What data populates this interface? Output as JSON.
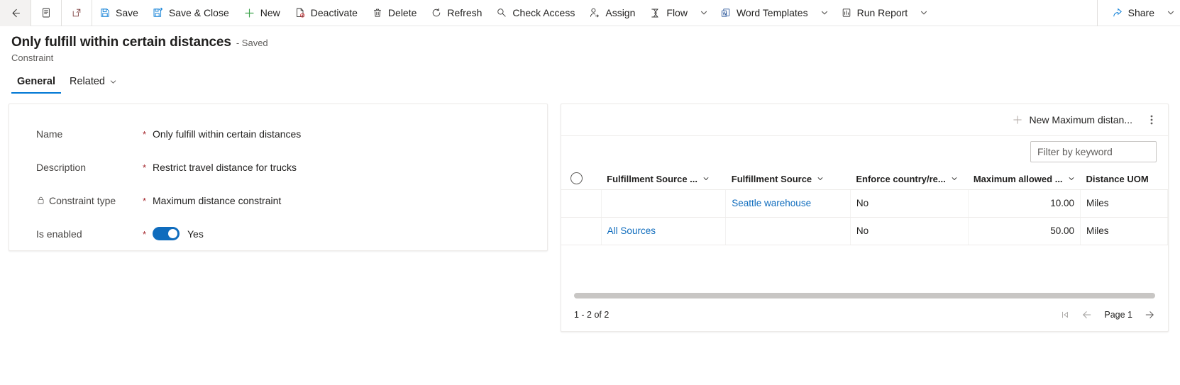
{
  "commandbar": {
    "back": {
      "label": "",
      "icon": "back-arrow-icon"
    },
    "form_selector": {
      "label": "",
      "icon": "form-icon"
    },
    "popout": {
      "label": "",
      "icon": "popout-icon"
    },
    "items": [
      {
        "label": "Save",
        "icon": "save-icon"
      },
      {
        "label": "Save & Close",
        "icon": "save-and-close-icon"
      },
      {
        "label": "New",
        "icon": "plus-icon"
      },
      {
        "label": "Deactivate",
        "icon": "deactivate-icon"
      },
      {
        "label": "Delete",
        "icon": "trash-icon"
      },
      {
        "label": "Refresh",
        "icon": "refresh-icon"
      },
      {
        "label": "Check Access",
        "icon": "key-icon"
      },
      {
        "label": "Assign",
        "icon": "person-assign-icon"
      },
      {
        "label": "Flow",
        "icon": "flow-icon",
        "caret": true
      },
      {
        "label": "Word Templates",
        "icon": "word-template-icon",
        "caret": true
      },
      {
        "label": "Run Report",
        "icon": "report-icon",
        "caret": true
      }
    ],
    "share": {
      "label": "Share",
      "icon": "share-icon",
      "caret": true
    }
  },
  "header": {
    "title": "Only fulfill within certain distances",
    "saved_status": "- Saved",
    "entity": "Constraint"
  },
  "tabs": [
    {
      "label": "General",
      "active": true,
      "caret": false
    },
    {
      "label": "Related",
      "active": false,
      "caret": true
    }
  ],
  "form": {
    "fields": [
      {
        "label": "Name",
        "required": "*",
        "value": "Only fulfill within certain distances",
        "locked": false,
        "type": "text"
      },
      {
        "label": "Description",
        "required": "*",
        "value": "Restrict travel distance for trucks",
        "locked": false,
        "type": "text"
      },
      {
        "label": "Constraint type",
        "required": "*",
        "value": "Maximum distance constraint",
        "locked": true,
        "type": "text"
      },
      {
        "label": "Is enabled",
        "required": "*",
        "value": "Yes",
        "locked": false,
        "type": "toggle",
        "toggle_on": true
      }
    ]
  },
  "subgrid": {
    "new_button_label": "New Maximum distan...",
    "new_button_icon": "plus-icon",
    "overflow_icon": "more-vertical-icon",
    "filter_placeholder": "Filter by keyword",
    "filter_value": "",
    "columns": [
      {
        "label": "Fulfillment Source ...",
        "caret": true,
        "align": "left"
      },
      {
        "label": "Fulfillment Source",
        "caret": true,
        "align": "left"
      },
      {
        "label": "Enforce country/re...",
        "caret": true,
        "align": "left"
      },
      {
        "label": "Maximum allowed ...",
        "caret": true,
        "align": "right"
      },
      {
        "label": "Distance UOM",
        "caret": false,
        "align": "left"
      }
    ],
    "rows": [
      {
        "fulfillment_source_group": "",
        "fulfillment_source": "Seattle warehouse",
        "fulfillment_source_is_link": true,
        "enforce_country": "No",
        "maximum_allowed": "10.00",
        "distance_uom": "Miles"
      },
      {
        "fulfillment_source_group": "All Sources",
        "fulfillment_source": "",
        "fulfillment_source_is_link": false,
        "enforce_country": "No",
        "maximum_allowed": "50.00",
        "distance_uom": "Miles"
      }
    ],
    "record_count": "1 - 2 of 2",
    "pager": {
      "first_label": "",
      "prev_label": "",
      "page_label": "Page 1",
      "next_label": ""
    }
  },
  "colors": {
    "accent": "#0f6cbd",
    "link": "#0f6cbd",
    "required": "#a4262c",
    "save_icon": "#0078d4",
    "new_icon": "#107c10",
    "delete_icon": "#605e5c"
  }
}
